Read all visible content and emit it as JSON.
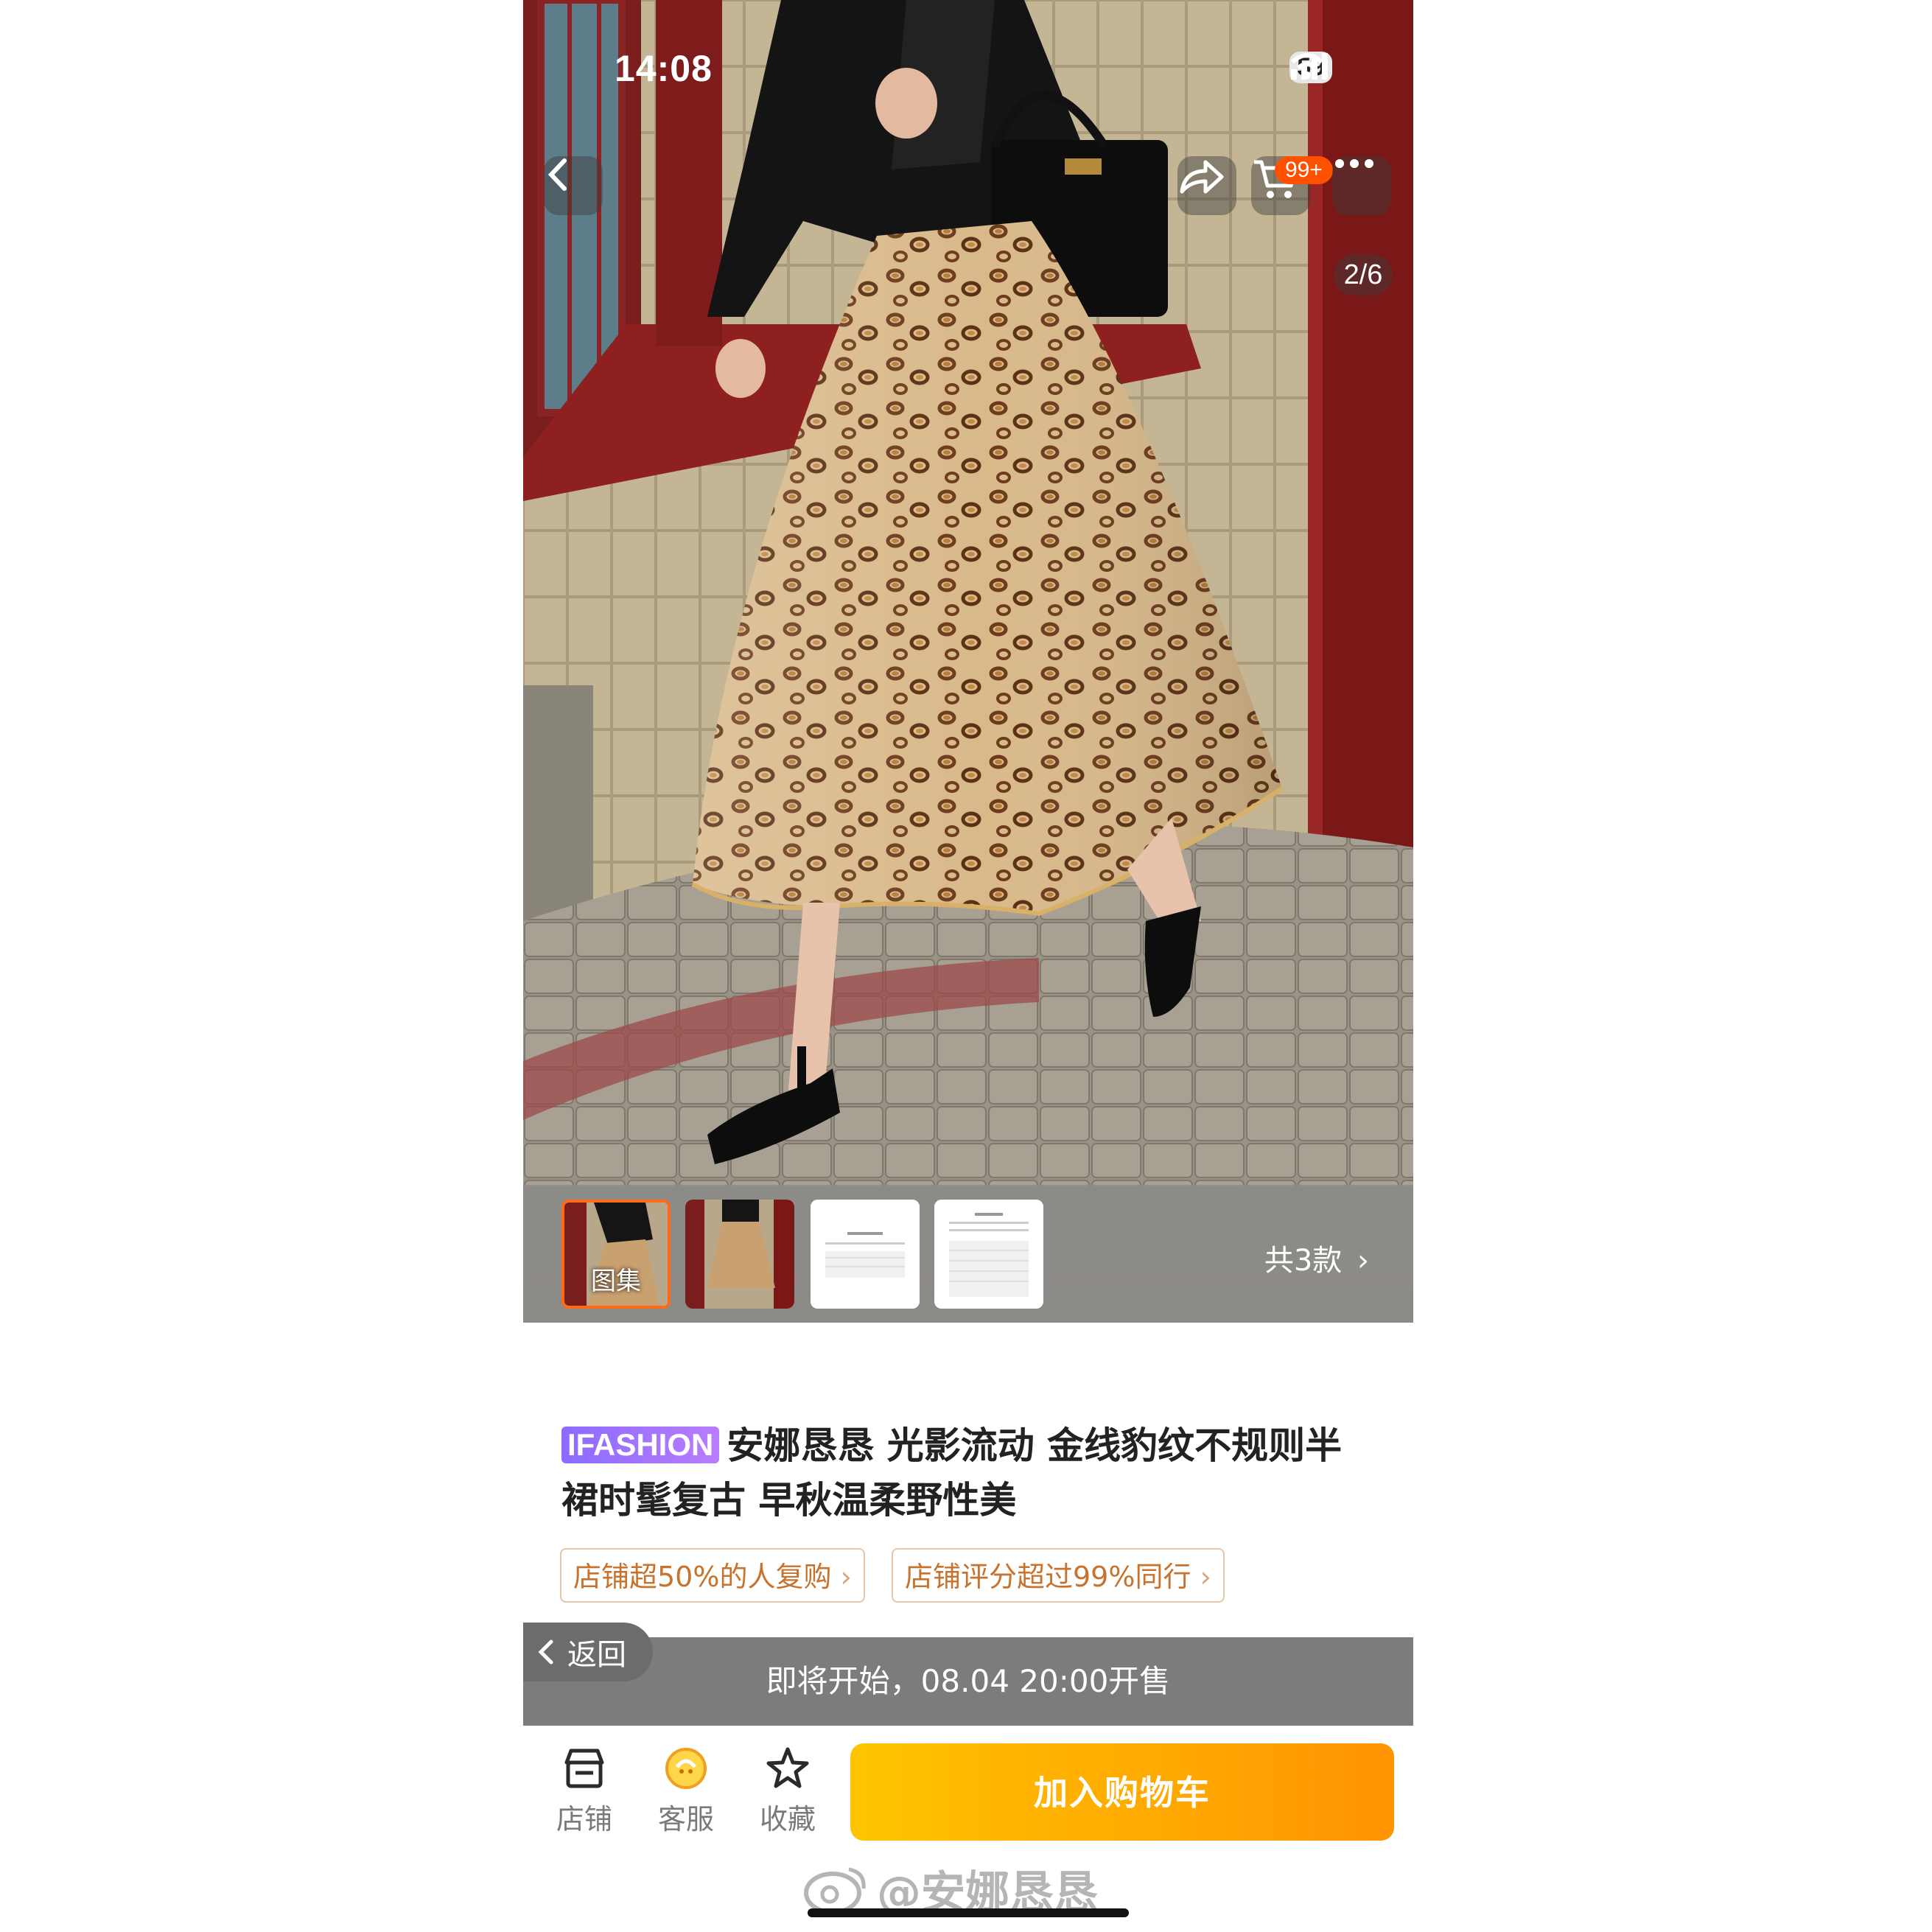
{
  "status_bar": {
    "time": "14:08",
    "battery": "59"
  },
  "top_nav": {
    "cart_badge": "99+",
    "page_indicator": "2/6"
  },
  "gallery": {
    "thumb_label": "图集",
    "variant_count": "共3款"
  },
  "product": {
    "brand_tag": "IFASHION",
    "title_line1": "安娜恳恳 光影流动 金线豹纹不规则半",
    "title_line2": "裙时髦复古 早秋温柔野性美",
    "chip_repurchase": "店铺超50%的人复购",
    "chip_rating": "店铺评分超过99%同行"
  },
  "presale": {
    "back_label": "返回",
    "notice": "即将开始，08.04 20:00开售"
  },
  "action_bar": {
    "shop": "店铺",
    "service": "客服",
    "favorite": "收藏",
    "add_to_cart": "加入购物车"
  },
  "watermark": "@安娜恳恳",
  "colors": {
    "accent": "#ff5000",
    "cta_start": "#ffc400",
    "cta_end": "#ff9402",
    "chip_text": "#c7732d"
  }
}
